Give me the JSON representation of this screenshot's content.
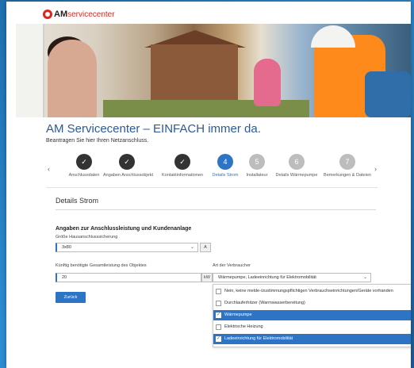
{
  "brand": {
    "am": "AM",
    "servicecenter": "servicecenter"
  },
  "page": {
    "title": "AM Servicecenter – EINFACH immer da.",
    "subtitle": "Beantragen Sie hier Ihren Netzanschluss."
  },
  "stepper": {
    "steps": [
      {
        "number": "",
        "label": "Anschlussdaten",
        "state": "done"
      },
      {
        "number": "",
        "label": "Angaben Anschlussobjekt",
        "state": "done"
      },
      {
        "number": "",
        "label": "Kontaktinformationen",
        "state": "done"
      },
      {
        "number": "4",
        "label": "Details Strom",
        "state": "active"
      },
      {
        "number": "5",
        "label": "Installateur",
        "state": "todo"
      },
      {
        "number": "6",
        "label": "Details Wärmepumpe",
        "state": "todo"
      },
      {
        "number": "7",
        "label": "Bemerkungen & Dateien",
        "state": "todo"
      }
    ],
    "prev_icon": "chevron-left-icon",
    "next_icon": "chevron-right-icon"
  },
  "section": {
    "title": "Details Strom",
    "heading": "Angaben zur Anschlussleistung und Kundenanlage"
  },
  "form": {
    "fuse": {
      "label": "Größe Hausanschlusssicherung",
      "value": "3x80",
      "unit": "A"
    },
    "power": {
      "label": "Künftig benötigte Gesamtleistung des Objektes",
      "value": "20",
      "unit": "kW"
    },
    "consumers": {
      "label": "Art der Verbraucher",
      "value": "Wärmepumpe, Ladeeinrichtung für Elektromobilität",
      "options": [
        {
          "label": "Nein, keine melde-/zustimmungspflichtigen Verbrauchseinrichtungen/Geräte vorhanden",
          "selected": false
        },
        {
          "label": "Durchlauferhitzer (Warmwasserbereitung)",
          "selected": false
        },
        {
          "label": "Wärmepumpe",
          "selected": true
        },
        {
          "label": "Elektrische Heizung",
          "selected": false
        },
        {
          "label": "Ladeeinrichtung für Elektromobilität",
          "selected": true
        }
      ]
    }
  },
  "buttons": {
    "back": "Zurück"
  },
  "colors": {
    "accent": "#2d74c4",
    "brand_red": "#e2251b",
    "title_blue": "#2a5a9c"
  }
}
